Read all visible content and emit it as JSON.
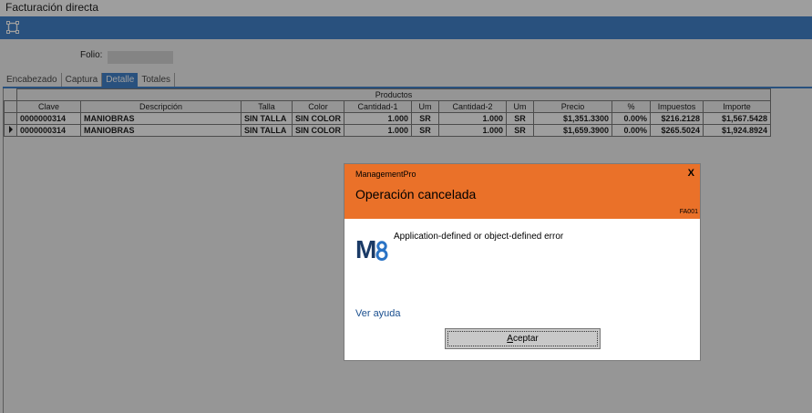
{
  "window": {
    "title": "Facturación directa"
  },
  "toolbar": {
    "icon": "crop-frame-icon"
  },
  "form": {
    "folio_label": "Folio:",
    "folio_value": ""
  },
  "tabs": [
    {
      "label": "Encabezado",
      "active": false
    },
    {
      "label": "Captura",
      "active": false
    },
    {
      "label": "Detalle",
      "active": true
    },
    {
      "label": "Totales",
      "active": false
    }
  ],
  "grid": {
    "group_header": "Productos",
    "columns": [
      "Clave",
      "Descripción",
      "Talla",
      "Color",
      "Cantidad-1",
      "Um",
      "Cantidad-2",
      "Um",
      "Precio",
      "%",
      "Impuestos",
      "Importe"
    ],
    "rows": [
      [
        "0000000314",
        "MANIOBRAS",
        "SIN TALLA",
        "SIN COLOR",
        "1.000",
        "SR",
        "1.000",
        "SR",
        "$1,351.3300",
        "0.00%",
        "$216.2128",
        "$1,567.5428"
      ],
      [
        "0000000314",
        "MANIOBRAS",
        "SIN TALLA",
        "SIN COLOR",
        "1.000",
        "SR",
        "1.000",
        "SR",
        "$1,659.3900",
        "0.00%",
        "$265.5024",
        "$1,924.8924"
      ]
    ],
    "current_row": 1
  },
  "dialog": {
    "app_name": "ManagementPro",
    "close_label": "X",
    "title": "Operación cancelada",
    "code": "FA001",
    "logo_text": "M8",
    "message": "Application-defined or object-defined error",
    "help_link": "Ver ayuda",
    "ok_button": "Aceptar"
  },
  "colors": {
    "accent_blue": "#2a73c5",
    "dialog_header": "#ea7129",
    "logo_navy": "#1a3a66"
  }
}
